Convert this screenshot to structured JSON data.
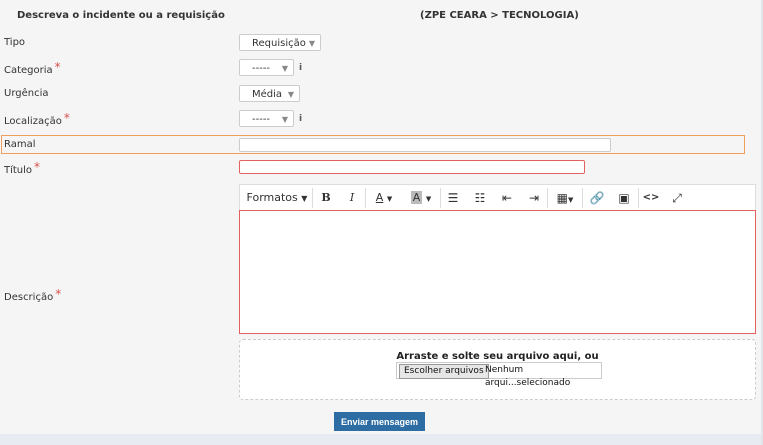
{
  "header": {
    "left_title": "Descreva o incidente ou a requisição",
    "right_title": "(ZPE CEARA > TECNOLOGIA)"
  },
  "fields": {
    "tipo": {
      "label": "Tipo",
      "value": "Requisição"
    },
    "categoria": {
      "label": "Categoria",
      "value": "-----"
    },
    "urgencia": {
      "label": "Urgência",
      "value": "Média"
    },
    "localizacao": {
      "label": "Localização",
      "value": "-----"
    },
    "ramal": {
      "label": "Ramal",
      "value": ""
    },
    "titulo": {
      "label": "Título",
      "value": ""
    },
    "descricao": {
      "label": "Descrição"
    }
  },
  "required_mark": "*",
  "info_glyph": "i",
  "toolbar": {
    "formats_label": "Formatos",
    "buttons": [
      "bold-icon",
      "italic-icon",
      "text-color-icon",
      "background-color-icon",
      "bullet-list-icon",
      "numbered-list-icon",
      "outdent-icon",
      "indent-icon",
      "table-icon",
      "link-icon",
      "image-icon",
      "code-icon",
      "fullscreen-icon"
    ]
  },
  "upload": {
    "dropzone_text": "Arraste e solte seu arquivo aqui, ou",
    "button_label": "Escolher arquivos",
    "file_status": "Nenhum arqui...selecionado"
  },
  "submit_label": "Enviar mensagem",
  "colors": {
    "required": "#d9534f",
    "error_border": "#e46060",
    "highlight_border": "#f0a05a",
    "submit_bg": "#2e6da4"
  }
}
